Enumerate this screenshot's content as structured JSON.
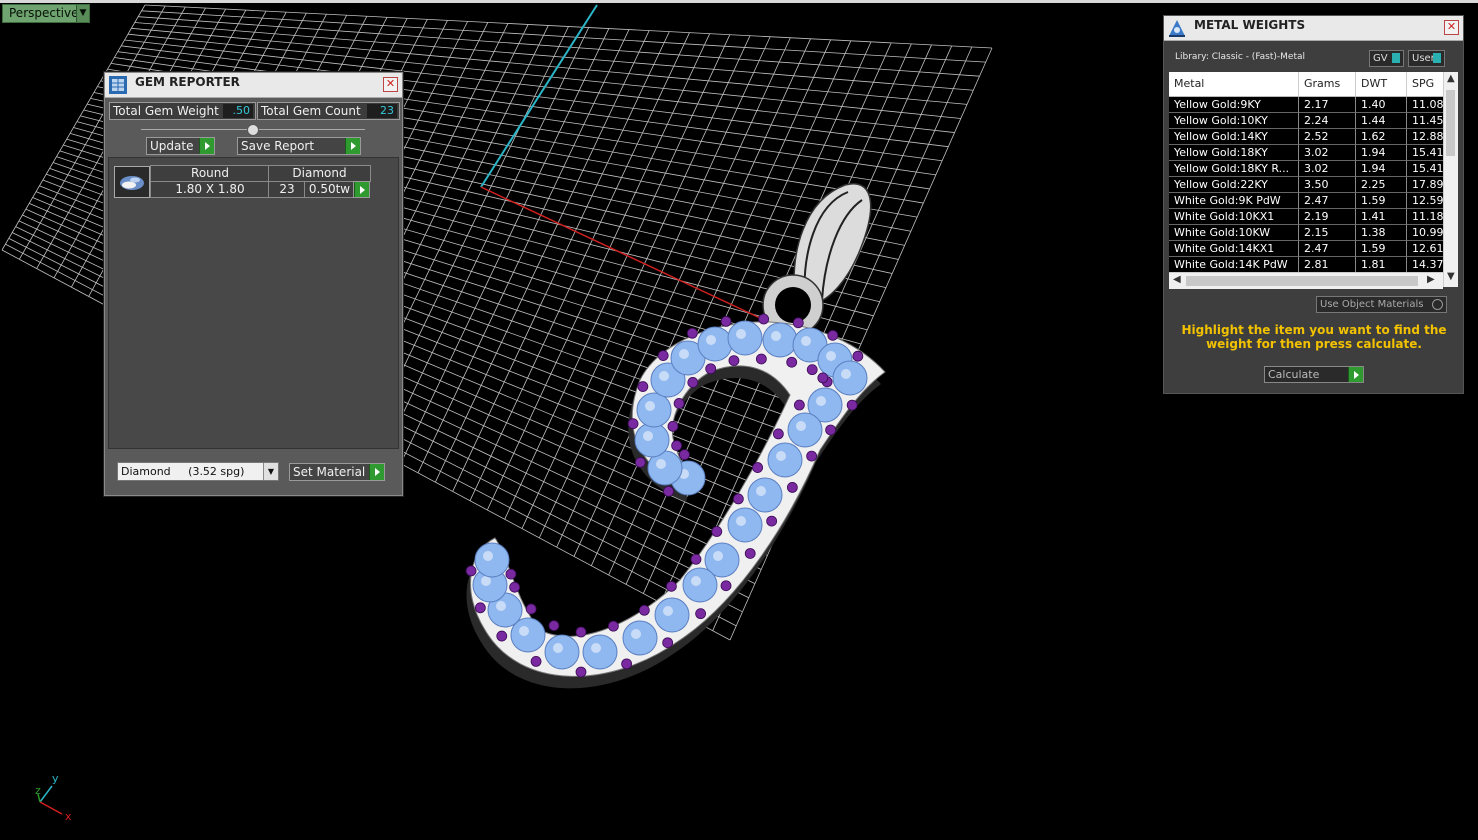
{
  "viewport": {
    "mode_label": "Perspective"
  },
  "gem_reporter": {
    "title": "GEM REPORTER",
    "total_weight_label": "Total Gem Weight",
    "total_weight_value": ".50",
    "total_count_label": "Total Gem Count",
    "total_count_value": "23",
    "update_label": "Update",
    "save_report_label": "Save Report",
    "gems": [
      {
        "shape": "Round",
        "material": "Diamond",
        "size": "1.80 X 1.80",
        "count": "23",
        "weight": "0.50tw"
      }
    ],
    "material_select": "Diamond     (3.52 spg)",
    "set_material_label": "Set Material"
  },
  "metal_weights": {
    "title": "METAL WEIGHTS",
    "library": "Library: Classic - (Fast)-Metal",
    "gv_label": "GV",
    "user_label": "User",
    "columns": [
      "Metal",
      "Grams",
      "DWT",
      "SPG"
    ],
    "rows": [
      [
        "Yellow Gold:9KY",
        "2.17",
        "1.40",
        "11.08"
      ],
      [
        "Yellow Gold:10KY",
        "2.24",
        "1.44",
        "11.45"
      ],
      [
        "Yellow Gold:14KY",
        "2.52",
        "1.62",
        "12.88"
      ],
      [
        "Yellow Gold:18KY",
        "3.02",
        "1.94",
        "15.41"
      ],
      [
        "Yellow Gold:18KY R...",
        "3.02",
        "1.94",
        "15.41"
      ],
      [
        "Yellow Gold:22KY",
        "3.50",
        "2.25",
        "17.89"
      ],
      [
        "White Gold:9K PdW",
        "2.47",
        "1.59",
        "12.59"
      ],
      [
        "White Gold:10KX1",
        "2.19",
        "1.41",
        "11.18"
      ],
      [
        "White Gold:10KW",
        "2.15",
        "1.38",
        "10.99"
      ],
      [
        "White Gold:14KX1",
        "2.47",
        "1.59",
        "12.61"
      ],
      [
        "White Gold:14K PdW",
        "2.81",
        "1.81",
        "14.37"
      ]
    ],
    "use_object_materials": "Use Object Materials",
    "hint": "Highlight the item you want to find the weight for then press calculate.",
    "calculate_label": "Calculate"
  },
  "axis": {
    "x": "x",
    "y": "y",
    "z": "z"
  },
  "colors": {
    "gem": "#8fb8f0",
    "prong": "#7a2aa0",
    "metal": "#f0f0f0",
    "grid": "#bdbdbd",
    "accent_green": "#2f9a2f"
  }
}
